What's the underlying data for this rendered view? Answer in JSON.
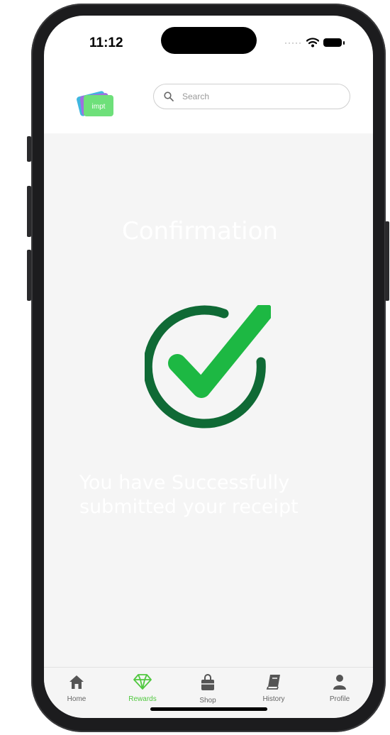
{
  "status_bar": {
    "time": "11:12"
  },
  "header": {
    "logo_text": "impt",
    "search_placeholder": "Search"
  },
  "main": {
    "title": "Confirmation",
    "message": "You have  Successfully submitted your receipt"
  },
  "tabbar": {
    "items": [
      {
        "label": "Home",
        "icon": "home-icon",
        "active": false
      },
      {
        "label": "Rewards",
        "icon": "diamond-icon",
        "active": true
      },
      {
        "label": "Shop",
        "icon": "shopping-bag-icon",
        "active": false
      },
      {
        "label": "History",
        "icon": "book-icon",
        "active": false
      },
      {
        "label": "Profile",
        "icon": "person-icon",
        "active": false
      }
    ]
  },
  "colors": {
    "accent_green": "#51c840",
    "check_dark": "#0f6a35",
    "check_bright": "#1db843",
    "background": "#f5f5f5"
  }
}
